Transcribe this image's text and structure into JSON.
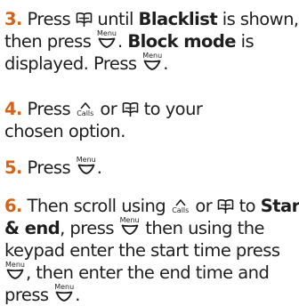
{
  "icons": {
    "book": "phonebook-icon",
    "menu": "menu-icon",
    "calls": "calls-icon",
    "menu_label": "Menu",
    "calls_label": "Calls"
  },
  "accent_color": "#d4621a",
  "steps": [
    {
      "number": "3.",
      "t1": " Press ",
      "t2": " until ",
      "h1": "Blacklist",
      "t3": " is shown,",
      "t4": "then press ",
      "t5": ". ",
      "h2": "Block mode",
      "t6": " is",
      "t7": "displayed. Press ",
      "t8": "."
    },
    {
      "number": "4.",
      "t1": " Press ",
      "t2": " or ",
      "t3": " to your",
      "t4": "chosen option."
    },
    {
      "number": "5.",
      "t1": " Press ",
      "t2": "."
    },
    {
      "number": "6.",
      "t1": " Then scroll using ",
      "t2": " or ",
      "t3": " to ",
      "h1": "Start",
      "h2": "& end",
      "t4": ", press ",
      "t5": " then using the",
      "t6": "keypad enter the start time press",
      "t7": ", then enter the end time and",
      "t8": "press ",
      "t9": "."
    }
  ]
}
